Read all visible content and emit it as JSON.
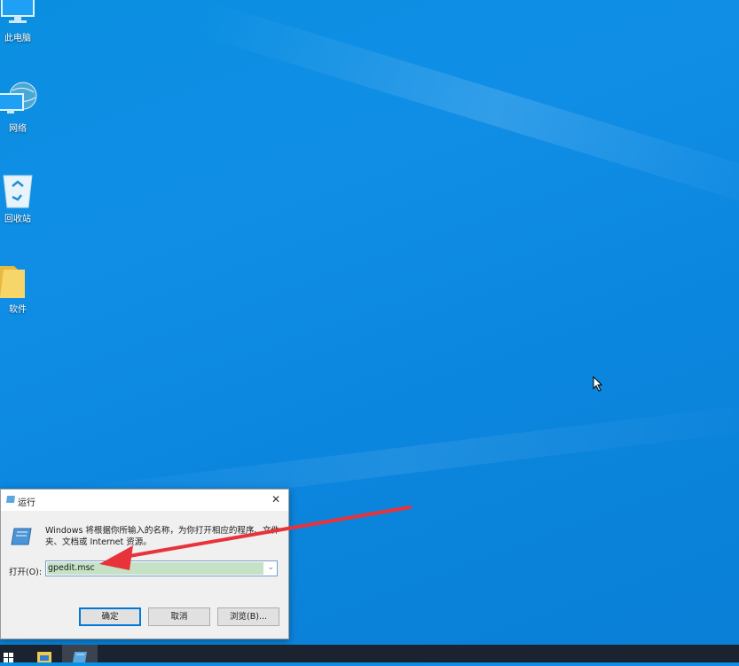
{
  "desktop": {
    "icons": [
      {
        "label": "此电脑",
        "icon": "computer-icon"
      },
      {
        "label": "网络",
        "icon": "network-icon"
      },
      {
        "label": "回收站",
        "icon": "recycle-bin-icon"
      },
      {
        "label": "软件",
        "icon": "folder-icon"
      }
    ]
  },
  "run_dialog": {
    "title": "运行",
    "description": "Windows 将根据你所输入的名称，为你打开相应的程序、文件夹、文档或 Internet 资源。",
    "open_label": "打开(O):",
    "input_value": "gpedit.msc",
    "ok_label": "确定",
    "cancel_label": "取消",
    "browse_label": "浏览(B)..."
  },
  "colors": {
    "desktop_bg": "#0b8ae2",
    "annotation_arrow": "#e8333a",
    "input_highlight": "#c6e2c6"
  }
}
